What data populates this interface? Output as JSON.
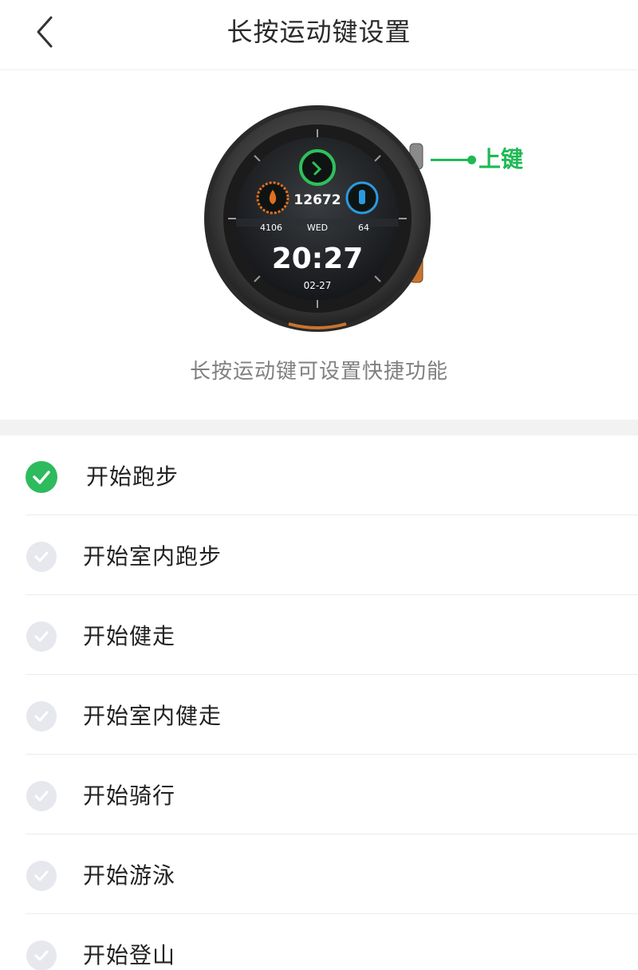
{
  "header": {
    "title": "长按运动键设置",
    "back_icon": "chevron-left-icon"
  },
  "hero": {
    "watch": {
      "steps": "12672",
      "calories": "4106",
      "weekday": "WED",
      "heart_rate": "64",
      "time": "20:27",
      "date": "02-27"
    },
    "key_label": "上键",
    "description": "长按运动键可设置快捷功能"
  },
  "options": [
    {
      "label": "开始跑步",
      "selected": true
    },
    {
      "label": "开始室内跑步",
      "selected": false
    },
    {
      "label": "开始健走",
      "selected": false
    },
    {
      "label": "开始室内健走",
      "selected": false
    },
    {
      "label": "开始骑行",
      "selected": false
    },
    {
      "label": "开始游泳",
      "selected": false
    },
    {
      "label": "开始登山",
      "selected": false
    }
  ],
  "colors": {
    "accent": "#2dbb5e",
    "callout": "#1fb955",
    "unselected": "#e6e8ee",
    "section_gap": "#f2f2f2"
  }
}
